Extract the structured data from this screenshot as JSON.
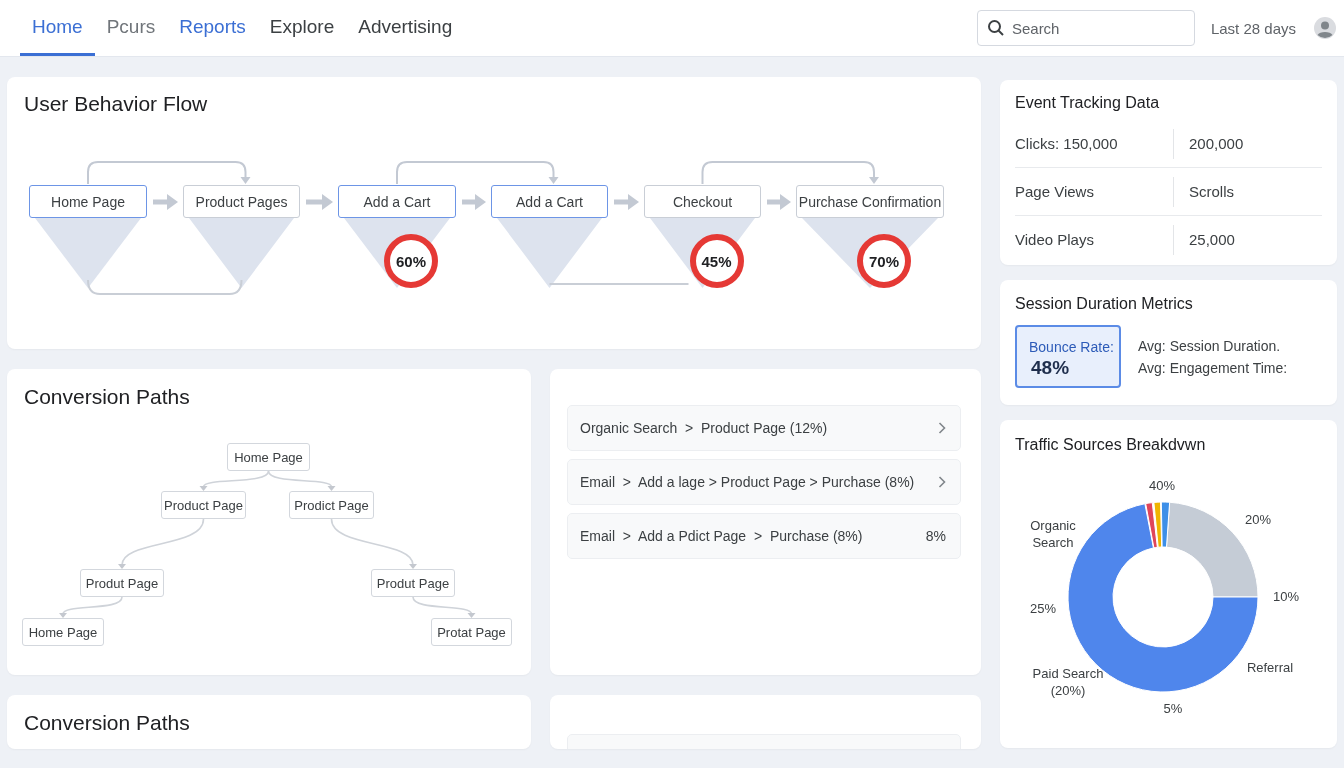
{
  "nav": {
    "tabs": [
      {
        "label": "Home",
        "selected": true,
        "color": "#3b6fd4"
      },
      {
        "label": "Pcurs",
        "selected": false,
        "color": "#70757a"
      },
      {
        "label": "Reports",
        "selected": false,
        "color": "#3b6fd4"
      },
      {
        "label": "Explore",
        "selected": false,
        "color": "#3c4043"
      },
      {
        "label": "Advertising",
        "selected": false,
        "color": "#3c4043"
      }
    ],
    "search": {
      "placeholder": "Search"
    },
    "date_range": "Last 28 days"
  },
  "behavior_flow": {
    "title": "User Behavior Flow",
    "steps": [
      {
        "label": "Home Page",
        "highlighted": true
      },
      {
        "label": "Product Pages",
        "highlighted": false
      },
      {
        "label": "Add a Cart",
        "highlighted": true,
        "badge": "60%"
      },
      {
        "label": "Add a Cart",
        "highlighted": true
      },
      {
        "label": "Checkout",
        "highlighted": false,
        "badge": "45%"
      },
      {
        "label": "Purchase Confirmation",
        "highlighted": false,
        "badge": "70%"
      }
    ]
  },
  "conversion_paths": {
    "title": "Conversion Paths",
    "tree": {
      "label": "Home Page",
      "children": [
        {
          "label": "Product Page",
          "children": [
            {
              "label": "Produt Page",
              "children": [
                {
                  "label": "Home Page"
                }
              ]
            }
          ]
        },
        {
          "label": "Prodict Page",
          "children": [
            {
              "label": "Produt Page",
              "children": [
                {
                  "label": "Protat Page"
                }
              ]
            }
          ]
        }
      ]
    }
  },
  "path_list": {
    "rows": [
      {
        "text": "Organic Search  >  Product Page (12%)",
        "kind": "chevron"
      },
      {
        "text": "Email  >  Add a lage > Product Page > Purchase (8%)",
        "kind": "chevron"
      },
      {
        "text": "Email  >  Add a Pdict Page  >  Purchase (8%)",
        "kind": "value",
        "value": "8%"
      }
    ]
  },
  "conversion_paths_lower": {
    "title": "Conversion Paths"
  },
  "event_tracking": {
    "title": "Event Tracking Data",
    "rows": [
      [
        "Clicks: 150,000",
        "200,000"
      ],
      [
        "Page Views",
        "Scrolls"
      ],
      [
        "Video Plays",
        "25,000"
      ]
    ]
  },
  "session_duration": {
    "title": "Session Duration Metrics",
    "highlight": {
      "label": "Bounce Rate:",
      "value": "48%"
    },
    "metrics": [
      "Avg: Session Duration.",
      "Avg: Engagement Time:"
    ]
  },
  "traffic_sources": {
    "title": "Traffic Sources Breakdvwn",
    "labels": [
      "40%",
      "Organic\nSearch",
      "20%",
      "10%",
      "25%",
      "Referral",
      "Paid Search\n(20%)",
      "5%"
    ]
  }
}
